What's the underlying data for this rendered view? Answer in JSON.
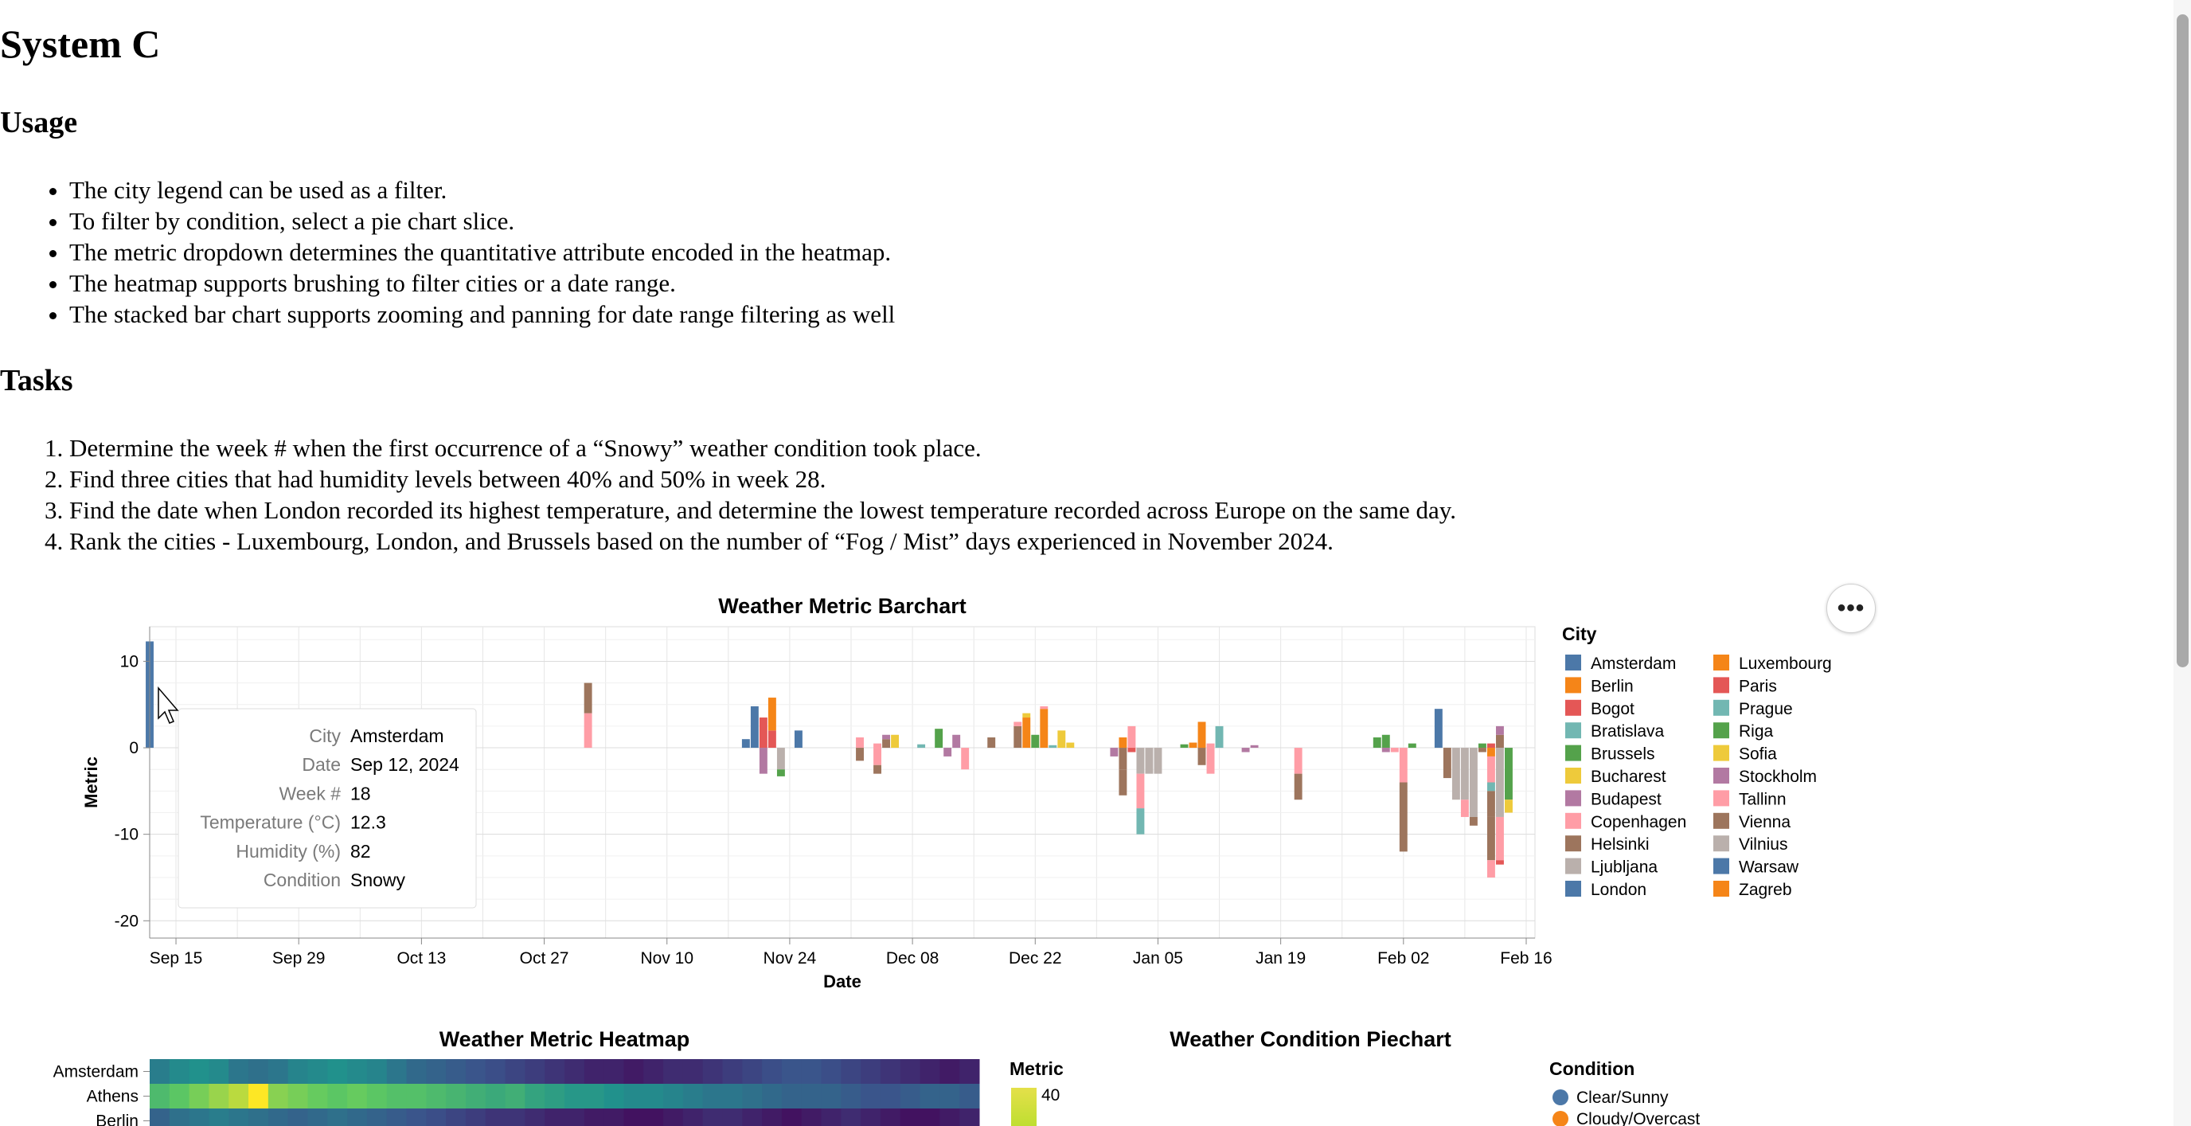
{
  "page": {
    "title": "System C",
    "usage_heading": "Usage",
    "usage_items": [
      "The city legend can be used as a filter.",
      "To filter by condition, select a pie chart slice.",
      "The metric dropdown determines the quantitative attribute encoded in the heatmap.",
      "The heatmap supports brushing to filter cities or a date range.",
      "The stacked bar chart supports zooming and panning for date range filtering as well"
    ],
    "tasks_heading": "Tasks",
    "tasks_items": [
      "Determine the week # when the first occurrence of a “Snowy” weather condition took place.",
      "Find three cities that had humidity levels between 40% and 50% in week 28.",
      "Find the date when London recorded its highest temperature, and determine the lowest temperature recorded across Europe on the same day.",
      "Rank the cities - Luxembourg, London, and Brussels based on the number of “Fog / Mist” days experienced in November 2024."
    ],
    "menu_button_label": "•••"
  },
  "tooltip": {
    "rows": [
      {
        "key": "City",
        "value": "Amsterdam"
      },
      {
        "key": "Date",
        "value": "Sep 12, 2024"
      },
      {
        "key": "Week #",
        "value": "18"
      },
      {
        "key": "Temperature (°C)",
        "value": "12.3"
      },
      {
        "key": "Humidity (%)",
        "value": "82"
      },
      {
        "key": "Condition",
        "value": "Snowy"
      }
    ]
  },
  "chart_data": [
    {
      "type": "bar",
      "stacked": true,
      "title": "Weather Metric Barchart",
      "xlabel": "Date",
      "ylabel": "Metric",
      "x_range": [
        "2024-09-12",
        "2025-02-17"
      ],
      "ylim": [
        -22,
        14
      ],
      "y_ticks": [
        10,
        0,
        -10,
        -20
      ],
      "x_ticks": [
        "Sep 15",
        "Sep 29",
        "Oct 13",
        "Oct 27",
        "Nov 10",
        "Nov 24",
        "Dec 08",
        "Dec 22",
        "Jan 05",
        "Jan 19",
        "Feb 02",
        "Feb 16"
      ],
      "x_tick_dates": [
        "2024-09-15",
        "2024-09-29",
        "2024-10-13",
        "2024-10-27",
        "2024-11-10",
        "2024-11-24",
        "2024-12-08",
        "2024-12-22",
        "2025-01-05",
        "2025-01-19",
        "2025-02-02",
        "2025-02-16"
      ],
      "grid": true,
      "legend_title": "City",
      "legend_position": "right",
      "cities": [
        {
          "name": "Amsterdam",
          "color": "#4c78a8"
        },
        {
          "name": "Berlin",
          "color": "#f58518"
        },
        {
          "name": "Bogot",
          "color": "#e45756"
        },
        {
          "name": "Bratislava",
          "color": "#72b7b2"
        },
        {
          "name": "Brussels",
          "color": "#54a24b"
        },
        {
          "name": "Bucharest",
          "color": "#eeca3b"
        },
        {
          "name": "Budapest",
          "color": "#b279a2"
        },
        {
          "name": "Copenhagen",
          "color": "#ff9da6"
        },
        {
          "name": "Helsinki",
          "color": "#9d755d"
        },
        {
          "name": "Ljubljana",
          "color": "#bab0ac"
        },
        {
          "name": "London",
          "color": "#4c78a8"
        },
        {
          "name": "Luxembourg",
          "color": "#f58518"
        },
        {
          "name": "Paris",
          "color": "#e45756"
        },
        {
          "name": "Prague",
          "color": "#72b7b2"
        },
        {
          "name": "Riga",
          "color": "#54a24b"
        },
        {
          "name": "Sofia",
          "color": "#eeca3b"
        },
        {
          "name": "Stockholm",
          "color": "#b279a2"
        },
        {
          "name": "Tallinn",
          "color": "#ff9da6"
        },
        {
          "name": "Vienna",
          "color": "#9d755d"
        },
        {
          "name": "Vilnius",
          "color": "#bab0ac"
        },
        {
          "name": "Warsaw",
          "color": "#4c78a8"
        },
        {
          "name": "Zagreb",
          "color": "#f58518"
        }
      ],
      "bars": [
        {
          "date": "2024-09-12",
          "segments": [
            {
              "city": "Amsterdam",
              "value": 12.3
            }
          ]
        },
        {
          "date": "2024-11-01",
          "segments": [
            {
              "city": "Copenhagen",
              "value": 4
            },
            {
              "city": "Helsinki",
              "value": 3.5
            }
          ]
        },
        {
          "date": "2024-11-19",
          "segments": [
            {
              "city": "Amsterdam",
              "value": 1
            }
          ]
        },
        {
          "date": "2024-11-20",
          "segments": [
            {
              "city": "Amsterdam",
              "value": 4.8
            }
          ]
        },
        {
          "date": "2024-11-21",
          "segments": [
            {
              "city": "Paris",
              "value": 3.5
            },
            {
              "city": "Budapest",
              "value": -3
            }
          ]
        },
        {
          "date": "2024-11-22",
          "segments": [
            {
              "city": "Paris",
              "value": 2
            },
            {
              "city": "Berlin",
              "value": 3.8
            }
          ]
        },
        {
          "date": "2024-11-23",
          "segments": [
            {
              "city": "Ljubljana",
              "value": -2.5
            },
            {
              "city": "Brussels",
              "value": -0.8
            }
          ]
        },
        {
          "date": "2024-11-25",
          "segments": [
            {
              "city": "Amsterdam",
              "value": 2
            }
          ]
        },
        {
          "date": "2024-12-02",
          "segments": [
            {
              "city": "Copenhagen",
              "value": 1.2
            },
            {
              "city": "Helsinki",
              "value": -1.5
            }
          ]
        },
        {
          "date": "2024-12-04",
          "segments": [
            {
              "city": "Copenhagen",
              "value": 0.5
            },
            {
              "city": "Copenhagen",
              "value": -2
            },
            {
              "city": "Helsinki",
              "value": -1
            }
          ]
        },
        {
          "date": "2024-12-05",
          "segments": [
            {
              "city": "Helsinki",
              "value": 1
            },
            {
              "city": "Budapest",
              "value": 0.5
            }
          ]
        },
        {
          "date": "2024-12-06",
          "segments": [
            {
              "city": "Bucharest",
              "value": 1.5
            }
          ]
        },
        {
          "date": "2024-12-09",
          "segments": [
            {
              "city": "Bratislava",
              "value": 0.4
            }
          ]
        },
        {
          "date": "2024-12-11",
          "segments": [
            {
              "city": "Brussels",
              "value": 2.2
            }
          ]
        },
        {
          "date": "2024-12-12",
          "segments": [
            {
              "city": "Budapest",
              "value": -1
            }
          ]
        },
        {
          "date": "2024-12-13",
          "segments": [
            {
              "city": "Budapest",
              "value": 1.5
            }
          ]
        },
        {
          "date": "2024-12-14",
          "segments": [
            {
              "city": "Copenhagen",
              "value": -2.5
            }
          ]
        },
        {
          "date": "2024-12-17",
          "segments": [
            {
              "city": "Helsinki",
              "value": 1.2
            }
          ]
        },
        {
          "date": "2024-12-20",
          "segments": [
            {
              "city": "Helsinki",
              "value": 2.5
            },
            {
              "city": "Copenhagen",
              "value": 0.5
            }
          ]
        },
        {
          "date": "2024-12-21",
          "segments": [
            {
              "city": "Berlin",
              "value": 3.5
            },
            {
              "city": "Bucharest",
              "value": 0.5
            }
          ]
        },
        {
          "date": "2024-12-22",
          "segments": [
            {
              "city": "Brussels",
              "value": 1.5
            }
          ]
        },
        {
          "date": "2024-12-23",
          "segments": [
            {
              "city": "Berlin",
              "value": 4.5
            },
            {
              "city": "Copenhagen",
              "value": 0.3
            }
          ]
        },
        {
          "date": "2024-12-24",
          "segments": [
            {
              "city": "Bratislava",
              "value": 0.3
            }
          ]
        },
        {
          "date": "2024-12-25",
          "segments": [
            {
              "city": "Bucharest",
              "value": 2
            }
          ]
        },
        {
          "date": "2024-12-26",
          "segments": [
            {
              "city": "Bucharest",
              "value": 0.6
            }
          ]
        },
        {
          "date": "2024-12-31",
          "segments": [
            {
              "city": "Budapest",
              "value": -1
            }
          ]
        },
        {
          "date": "2025-01-01",
          "segments": [
            {
              "city": "Berlin",
              "value": 1.2
            },
            {
              "city": "Helsinki",
              "value": -2.5
            },
            {
              "city": "Helsinki",
              "value": -3
            }
          ]
        },
        {
          "date": "2025-01-02",
          "segments": [
            {
              "city": "Copenhagen",
              "value": 2.5
            },
            {
              "city": "Paris",
              "value": -0.5
            }
          ]
        },
        {
          "date": "2025-01-03",
          "segments": [
            {
              "city": "Ljubljana",
              "value": -3
            },
            {
              "city": "Copenhagen",
              "value": -4
            },
            {
              "city": "Bratislava",
              "value": -3
            }
          ]
        },
        {
          "date": "2025-01-04",
          "segments": [
            {
              "city": "Ljubljana",
              "value": -3
            }
          ]
        },
        {
          "date": "2025-01-05",
          "segments": [
            {
              "city": "Ljubljana",
              "value": -3
            }
          ]
        },
        {
          "date": "2025-01-08",
          "segments": [
            {
              "city": "Brussels",
              "value": 0.4
            }
          ]
        },
        {
          "date": "2025-01-09",
          "segments": [
            {
              "city": "Berlin",
              "value": 0.6
            }
          ]
        },
        {
          "date": "2025-01-10",
          "segments": [
            {
              "city": "Berlin",
              "value": 3
            },
            {
              "city": "Helsinki",
              "value": -2
            }
          ]
        },
        {
          "date": "2025-01-11",
          "segments": [
            {
              "city": "Copenhagen",
              "value": -3
            },
            {
              "city": "Copenhagen",
              "value": 0.5
            }
          ]
        },
        {
          "date": "2025-01-12",
          "segments": [
            {
              "city": "Bratislava",
              "value": 2.5
            }
          ]
        },
        {
          "date": "2025-01-15",
          "segments": [
            {
              "city": "Budapest",
              "value": -0.5
            }
          ]
        },
        {
          "date": "2025-01-16",
          "segments": [
            {
              "city": "Budapest",
              "value": 0.3
            }
          ]
        },
        {
          "date": "2025-01-21",
          "segments": [
            {
              "city": "Copenhagen",
              "value": -3
            },
            {
              "city": "Helsinki",
              "value": -3
            }
          ]
        },
        {
          "date": "2025-01-30",
          "segments": [
            {
              "city": "Brussels",
              "value": 1.2
            }
          ]
        },
        {
          "date": "2025-01-31",
          "segments": [
            {
              "city": "Brussels",
              "value": 1.5
            },
            {
              "city": "Budapest",
              "value": -0.5
            }
          ]
        },
        {
          "date": "2025-02-01",
          "segments": [
            {
              "city": "Copenhagen",
              "value": -0.5
            }
          ]
        },
        {
          "date": "2025-02-02",
          "segments": [
            {
              "city": "Copenhagen",
              "value": -4
            },
            {
              "city": "Helsinki",
              "value": -8
            }
          ]
        },
        {
          "date": "2025-02-03",
          "segments": [
            {
              "city": "Brussels",
              "value": 0.5
            }
          ]
        },
        {
          "date": "2025-02-06",
          "segments": [
            {
              "city": "Amsterdam",
              "value": 4.5
            }
          ]
        },
        {
          "date": "2025-02-07",
          "segments": [
            {
              "city": "Helsinki",
              "value": -3.5
            }
          ]
        },
        {
          "date": "2025-02-08",
          "segments": [
            {
              "city": "Ljubljana",
              "value": -6
            }
          ]
        },
        {
          "date": "2025-02-09",
          "segments": [
            {
              "city": "Ljubljana",
              "value": -6
            },
            {
              "city": "Copenhagen",
              "value": -2
            }
          ]
        },
        {
          "date": "2025-02-10",
          "segments": [
            {
              "city": "Ljubljana",
              "value": -8
            },
            {
              "city": "Helsinki",
              "value": -1
            }
          ]
        },
        {
          "date": "2025-02-11",
          "segments": [
            {
              "city": "Brussels",
              "value": 0.5
            },
            {
              "city": "Helsinki",
              "value": -0.5
            }
          ]
        },
        {
          "date": "2025-02-12",
          "segments": [
            {
              "city": "Bogot",
              "value": 0.5
            },
            {
              "city": "Berlin",
              "value": -1
            },
            {
              "city": "Copenhagen",
              "value": -3
            },
            {
              "city": "Bratislava",
              "value": -1
            },
            {
              "city": "Helsinki",
              "value": -3
            },
            {
              "city": "Helsinki",
              "value": -5
            },
            {
              "city": "Copenhagen",
              "value": -2
            }
          ]
        },
        {
          "date": "2025-02-13",
          "segments": [
            {
              "city": "Helsinki",
              "value": 1.5
            },
            {
              "city": "Budapest",
              "value": 1
            },
            {
              "city": "Ljubljana",
              "value": -8
            },
            {
              "city": "Copenhagen",
              "value": -5
            },
            {
              "city": "Paris",
              "value": -0.5
            }
          ]
        },
        {
          "date": "2025-02-14",
          "segments": [
            {
              "city": "Brussels",
              "value": -6
            },
            {
              "city": "Bucharest",
              "value": -1.5
            }
          ]
        }
      ]
    },
    {
      "type": "heatmap",
      "title": "Weather Metric Heatmap",
      "rows": [
        "Amsterdam",
        "Athens",
        "Berlin"
      ],
      "legend_title": "Metric",
      "legend_values": [
        40
      ],
      "values": [
        [
          18,
          20,
          21,
          20,
          17,
          16,
          17,
          19,
          20,
          21,
          20,
          19,
          17,
          15,
          14,
          13,
          12,
          11,
          10,
          9,
          8,
          7,
          6,
          6,
          5,
          6,
          7,
          7,
          8,
          9,
          10,
          11,
          12,
          12,
          11,
          10,
          9,
          8,
          7,
          6,
          5,
          6
        ],
        [
          28,
          30,
          32,
          34,
          36,
          40,
          33,
          32,
          31,
          30,
          31,
          30,
          29,
          29,
          28,
          27,
          26,
          25,
          26,
          24,
          23,
          22,
          22,
          21,
          20,
          20,
          19,
          18,
          17,
          17,
          16,
          15,
          14,
          14,
          14,
          13,
          12,
          12,
          13,
          14,
          14,
          13
        ],
        [
          14,
          16,
          17,
          18,
          17,
          16,
          15,
          14,
          15,
          16,
          15,
          14,
          13,
          12,
          11,
          10,
          9,
          8,
          8,
          7,
          6,
          6,
          5,
          5,
          4,
          4,
          5,
          6,
          7,
          7,
          6,
          5,
          4,
          5,
          6,
          7,
          6,
          5,
          4,
          4,
          5,
          6
        ]
      ]
    },
    {
      "type": "pie",
      "title": "Weather Condition Piechart",
      "legend_title": "Condition",
      "legend_position": "right",
      "labels": [
        "Clear/Sunny",
        "Cloudy/Overcast"
      ],
      "colors": [
        "#4c78a8",
        "#f58518"
      ]
    }
  ]
}
